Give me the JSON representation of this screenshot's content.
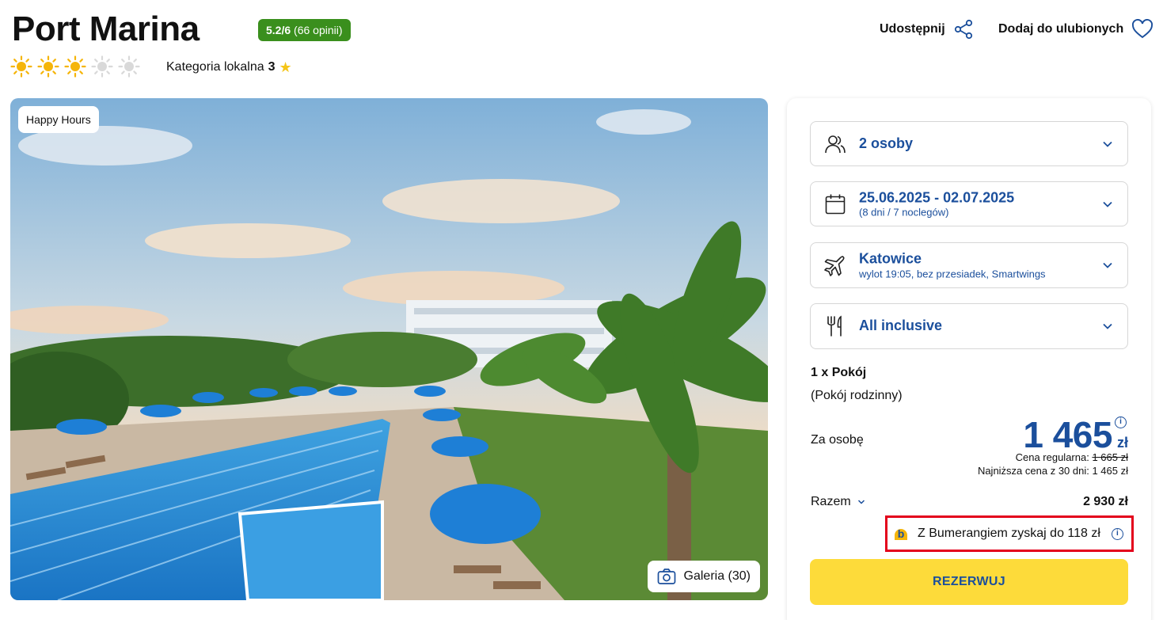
{
  "hotel": {
    "name": "Port Marina",
    "rating_score": "5.2/6",
    "rating_count": "(66 opinii)",
    "suns_total": 5,
    "suns_filled": 3,
    "category_prefix": "Kategoria lokalna",
    "category_value": "3"
  },
  "header_actions": {
    "share_label": "Udostępnij",
    "favorite_label": "Dodaj do ulubionych"
  },
  "hero": {
    "badge": "Happy Hours",
    "gallery_label": "Galeria (30)"
  },
  "booking": {
    "persons": {
      "label": "2 osoby",
      "icon": "users-icon"
    },
    "dates": {
      "label": "25.06.2025 - 02.07.2025",
      "sub": "(8 dni / 7 noclegów)",
      "icon": "calendar-icon"
    },
    "flight": {
      "label": "Katowice",
      "sub": "wylot 19:05, bez przesiadek, Smartwings",
      "icon": "plane-icon"
    },
    "board": {
      "label": "All inclusive",
      "icon": "cutlery-icon"
    },
    "room_line1": "1 x Pokój",
    "room_line2": "(Pokój rodzinny)",
    "per_person_label": "Za osobę",
    "price": "1 465",
    "currency": "zł",
    "regular_price_label": "Cena regularna:",
    "regular_price": "1 665 zł",
    "lowest_price_text": "Najniższa cena z 30 dni: 1 465 zł",
    "total_label": "Razem",
    "total_value": "2 930 zł",
    "bumerang_text": "Z Bumerangiem zyskaj do 118 zł",
    "book_button": "REZERWUJ"
  },
  "colors": {
    "accent_blue": "#1b4f9c",
    "rating_green": "#3a8f1d",
    "button_yellow": "#fddb3a",
    "highlight_red": "#e3001b",
    "sun_yellow": "#f5b50a"
  }
}
